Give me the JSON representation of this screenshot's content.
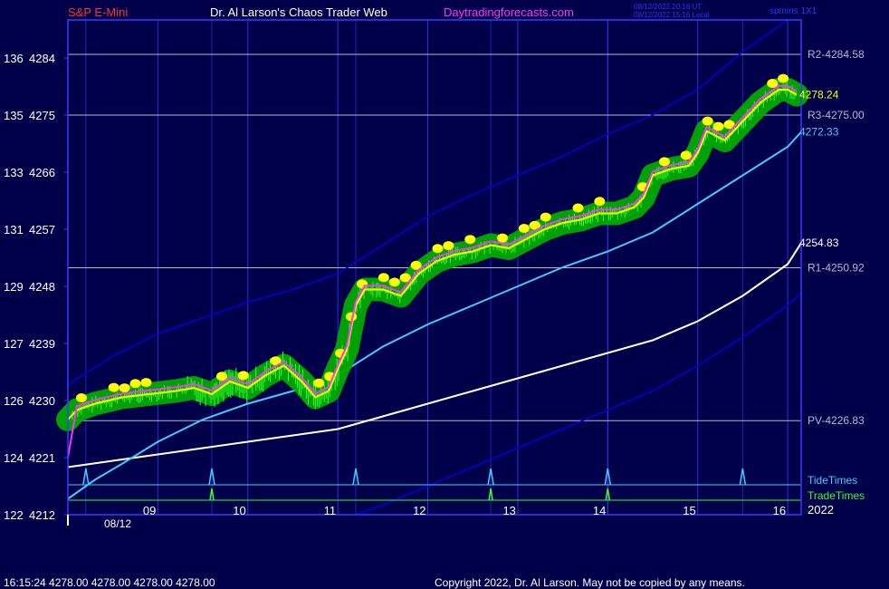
{
  "header": {
    "instrument": "S&P E-Mini",
    "title": "Dr. Al Larson's Chaos Trader Web",
    "website": "Daytradingforecasts.com",
    "utc_time": "08/12/2022 20:16 UT",
    "local_time": "08/12/2022 15:16 Local",
    "setting": "spmins 1X1"
  },
  "footer": {
    "quote": "16:15:24  4278.00 4278.00 4278.00 4278.00",
    "copyright": "Copyright 2022, Dr. Al Larson. May not be copied by any means."
  },
  "colors": {
    "background": "#00004a",
    "frame": "#3a3aff",
    "price": "#ffff00",
    "average": "#ff33ff",
    "glow": "#00aa00",
    "cyan_line": "#44ccff",
    "white_line": "#ffffff",
    "band": "#0000dd",
    "green_ticks": "#33ff33"
  },
  "chart_data": {
    "type": "line",
    "title": "S&P E-Mini",
    "x_axis": {
      "ticks": [
        "09",
        "10",
        "11",
        "12",
        "13",
        "14",
        "15",
        "16"
      ],
      "tick_hours": [
        9,
        10,
        11,
        12,
        13,
        14,
        15,
        16
      ],
      "date_label": "08/12",
      "year_label": "2022",
      "range_hours": [
        8,
        16.15
      ]
    },
    "y_axis": {
      "ticks": [
        {
          "label": "122",
          "price": "4212"
        },
        {
          "label": "124",
          "price": "4221"
        },
        {
          "label": "126",
          "price": "4230"
        },
        {
          "label": "127",
          "price": "4239"
        },
        {
          "label": "129",
          "price": "4248"
        },
        {
          "label": "131",
          "price": "4257"
        },
        {
          "label": "133",
          "price": "4266"
        },
        {
          "label": "135",
          "price": "4275"
        },
        {
          "label": "136",
          "price": "4284"
        }
      ],
      "tick_values": [
        4212,
        4221,
        4230,
        4239,
        4248,
        4257,
        4266,
        4275,
        4284
      ],
      "range": [
        4212,
        4290
      ]
    },
    "levels": [
      {
        "label": "R2-4284.58",
        "value": 4284.58
      },
      {
        "label": "R3-4275.00",
        "value": 4275.0
      },
      {
        "label": "R1-4250.92",
        "value": 4250.92
      },
      {
        "label": "PV-4226.83",
        "value": 4226.83
      }
    ],
    "end_labels": [
      {
        "label": "4278.24",
        "value": 4278.24,
        "series": "price"
      },
      {
        "label": "4272.33",
        "value": 4272.33,
        "series": "cyan"
      },
      {
        "label": "4254.83",
        "value": 4254.83,
        "series": "white"
      }
    ],
    "tide_times": [
      8.2,
      9.6,
      11.2,
      12.7,
      14.0,
      15.5
    ],
    "trade_times": [
      9.6,
      12.7,
      14.0
    ],
    "timing_labels": {
      "tide": "TideTimes",
      "trade": "TradeTimes"
    },
    "series": [
      {
        "key": "price",
        "x": [
          8.0,
          8.1,
          8.3,
          8.6,
          8.9,
          9.2,
          9.4,
          9.6,
          9.8,
          10.0,
          10.2,
          10.4,
          10.6,
          10.75,
          10.9,
          11.0,
          11.1,
          11.2,
          11.3,
          11.5,
          11.7,
          11.9,
          12.1,
          12.3,
          12.5,
          12.7,
          12.9,
          13.1,
          13.3,
          13.5,
          13.7,
          13.9,
          14.1,
          14.3,
          14.4,
          14.5,
          14.7,
          14.9,
          15.0,
          15.1,
          15.3,
          15.5,
          15.7,
          15.9,
          16.0,
          16.1
        ],
        "y": [
          4227,
          4228.5,
          4229.5,
          4230.5,
          4231,
          4231.5,
          4232,
          4231,
          4233,
          4232,
          4234,
          4235.5,
          4233,
          4230.5,
          4231.5,
          4235,
          4238,
          4245,
          4247.5,
          4247.5,
          4246.5,
          4250,
          4252,
          4253,
          4253.5,
          4254.5,
          4254,
          4255.5,
          4257,
          4258,
          4258.5,
          4259.5,
          4259.5,
          4260.5,
          4262,
          4265.5,
          4266.5,
          4267,
          4269,
          4272.5,
          4271,
          4274,
          4277,
          4279,
          4279,
          4278.2
        ]
      },
      {
        "key": "cyan",
        "x": [
          8.0,
          8.3,
          8.6,
          9.0,
          9.5,
          10.0,
          10.5,
          11.0,
          11.5,
          12.0,
          12.5,
          13.0,
          13.5,
          14.0,
          14.5,
          15.0,
          15.5,
          16.0,
          16.15
        ],
        "y": [
          4214.5,
          4217.5,
          4220,
          4223.5,
          4227,
          4229.5,
          4231.5,
          4234,
          4238.5,
          4242,
          4245,
          4248,
          4251,
          4253.5,
          4256.5,
          4261,
          4265.5,
          4270,
          4272.33
        ]
      },
      {
        "key": "white",
        "x": [
          8.0,
          8.5,
          9.0,
          9.5,
          10.0,
          10.5,
          11.0,
          11.5,
          12.0,
          12.5,
          13.0,
          13.5,
          14.0,
          14.5,
          15.0,
          15.5,
          16.0,
          16.15
        ],
        "y": [
          4219.5,
          4220.5,
          4221.5,
          4222.5,
          4223.5,
          4224.5,
          4225.5,
          4227.5,
          4229.5,
          4231.5,
          4233.5,
          4235.5,
          4237.5,
          4239.5,
          4242.5,
          4246.5,
          4251.5,
          4254.83
        ]
      },
      {
        "key": "band_upper",
        "x": [
          8.0,
          8.5,
          9.0,
          9.5,
          10.0,
          10.5,
          11.0,
          11.5,
          12.0,
          12.5,
          13.0,
          13.5,
          14.0,
          14.5,
          15.0,
          15.5,
          16.0
        ],
        "y": [
          4232.5,
          4237,
          4240.5,
          4243,
          4245.5,
          4247.5,
          4250,
          4254.5,
          4259,
          4262.5,
          4265.5,
          4268.5,
          4272,
          4275,
          4279,
          4285,
          4292
        ]
      },
      {
        "key": "band_lower",
        "x": [
          11.2,
          11.5,
          12.0,
          12.5,
          13.0,
          13.5,
          14.0,
          14.5,
          15.0,
          15.5,
          16.0,
          16.15
        ],
        "y": [
          4212,
          4213.5,
          4216.5,
          4219.5,
          4222.5,
          4225.5,
          4228.5,
          4231.5,
          4235.5,
          4240,
          4245,
          4247
        ]
      }
    ]
  }
}
